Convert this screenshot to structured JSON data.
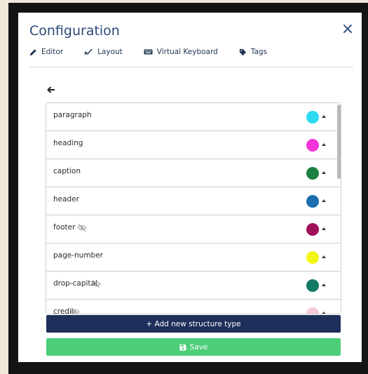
{
  "dialog": {
    "title": "Configuration",
    "close_label": "×"
  },
  "tabs": [
    {
      "label": "Editor",
      "icon": "pencil-icon"
    },
    {
      "label": "Layout",
      "icon": "layout-icon"
    },
    {
      "label": "Virtual Keyboard",
      "icon": "keyboard-icon"
    },
    {
      "label": "Tags",
      "icon": "tag-icon"
    }
  ],
  "back": {
    "icon": "arrow-left-icon"
  },
  "structures": [
    {
      "label": "paragraph",
      "color": "#2bd9f0",
      "hidden": false
    },
    {
      "label": "heading",
      "color": "#f533d9",
      "hidden": false
    },
    {
      "label": "caption",
      "color": "#1d8043",
      "hidden": false
    },
    {
      "label": "header",
      "color": "#1a6fb0",
      "hidden": false
    },
    {
      "label": "footer",
      "color": "#a0105a",
      "hidden": true
    },
    {
      "label": "page-number",
      "color": "#f5f515",
      "hidden": false
    },
    {
      "label": "drop-capital",
      "color": "#137a63",
      "hidden": true
    },
    {
      "label": "credit",
      "color": "#f6c8d6",
      "hidden": true
    }
  ],
  "buttons": {
    "add_label": "+ Add new structure type",
    "save_label": "Save"
  }
}
